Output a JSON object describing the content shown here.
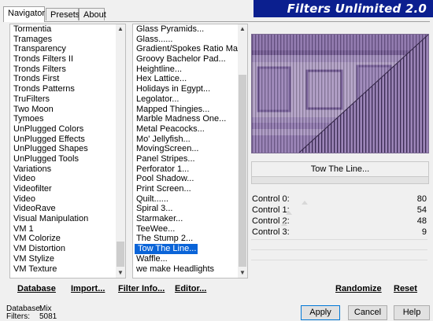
{
  "tabs": [
    "Navigator",
    "Presets",
    "About"
  ],
  "banner_title": "Filters Unlimited 2.0",
  "categories": [
    "Tormentia",
    "Tramages",
    "Transparency",
    "Tronds Filters II",
    "Tronds Filters",
    "Tronds First",
    "Tronds Patterns",
    "TruFilters",
    "Two Moon",
    "Tymoes",
    "UnPlugged Colors",
    "UnPlugged Effects",
    "UnPlugged Shapes",
    "UnPlugged Tools",
    "Variations",
    "Video",
    "Videofilter",
    "Video",
    "VideoRave",
    "Visual Manipulation",
    "VM 1",
    "VM Colorize",
    "VM Distortion",
    "VM Stylize",
    "VM Texture"
  ],
  "filters": [
    "Glass Pyramids...",
    "Glass......",
    "Gradient/Spokes Ratio Maker...",
    "Groovy Bachelor Pad...",
    "Heightline...",
    "Hex Lattice...",
    "Holidays in Egypt...",
    "Legolator...",
    "Mapped Thingies...",
    "Marble Madness One...",
    "Metal Peacocks...",
    "Mo' Jellyfish...",
    "MovingScreen...",
    "Panel Stripes...",
    "Perforator 1...",
    "Pool Shadow...",
    "Print Screen...",
    "Quilt......",
    "Spiral 3...",
    "Starmaker...",
    "TeeWee...",
    "The Stump 2...",
    "Tow The Line...",
    "Waffle...",
    "we make Headlights"
  ],
  "selected_filter": "Tow The Line...",
  "links": {
    "database": "Database",
    "import": "Import...",
    "filter_info": "Filter Info...",
    "editor": "Editor...",
    "randomize": "Randomize",
    "reset": "Reset"
  },
  "controls": [
    {
      "label": "Control 0:",
      "value": "80"
    },
    {
      "label": "Control 1:",
      "value": "54"
    },
    {
      "label": "Control 2:",
      "value": "48"
    },
    {
      "label": "Control 3:",
      "value": "9"
    }
  ],
  "status": {
    "database_label": "Database:",
    "database_value": "Mix",
    "filters_label": "Filters:",
    "filters_value": "5081"
  },
  "buttons": {
    "apply": "Apply",
    "cancel": "Cancel",
    "help": "Help"
  }
}
